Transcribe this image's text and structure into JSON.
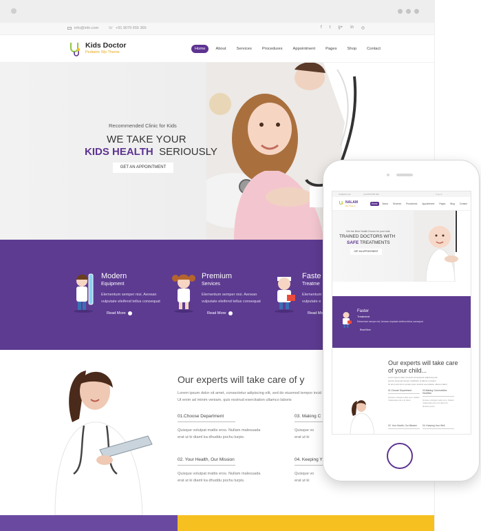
{
  "topbar": {
    "email": "info@info.com",
    "phone": "+91 9079 655 366",
    "social_icons": [
      "facebook-icon",
      "twitter-icon",
      "google-plus-icon",
      "linkedin-icon",
      "dribbble-icon"
    ],
    "social_glyphs": [
      "f",
      "t",
      "g+",
      "in",
      "◎"
    ]
  },
  "header": {
    "logo_name": "Kids Doctor",
    "logo_tagline": "Pediatric Wp Theme",
    "nav": [
      "Home",
      "About",
      "Services",
      "Procedures",
      "Appointment",
      "Pages",
      "Shop",
      "Contact"
    ],
    "active_nav": "Home"
  },
  "hero": {
    "kicker": "Recommended Clinic for Kids",
    "title_line1": "WE TAKE YOUR",
    "title_highlight": "KIDS HEALTH",
    "title_rest": "SERIOUSLY",
    "cta": "GET AN APPOINTMENT"
  },
  "features": [
    {
      "title": "Modern",
      "subtitle": "Equipment",
      "desc_line1": "Elementum semper nisi. Aenean",
      "desc_line2": "vulputate eleifend tellus consequat",
      "more": "Read More"
    },
    {
      "title": "Premium",
      "subtitle": "Services",
      "desc_line1": "Elementum semper nisi. Aenean",
      "desc_line2": "vulputate eleifend tellus consequat",
      "more": "Read More"
    },
    {
      "title": "Faste",
      "subtitle": "Treatme",
      "desc_line1": "Elementum",
      "desc_line2": "vulputate e",
      "more": "Read More"
    }
  ],
  "experts": {
    "title": "Our experts will take care of y",
    "intro_line1": "Lorem ipsum dolor sit amet, consectetur adipiscing elit, sed do eiusmod tempor incid",
    "intro_line2": "Ut enim ad minim veniam, quis nostrud exercitation ullamco laboris",
    "items": [
      {
        "heading": "01.Choose Department",
        "line1": "Quisque volutpat mattis eros. Nullam malesuada",
        "line2": "erat ut ki diaml ka dhuddu pochu turpis."
      },
      {
        "heading": "03. Making C",
        "line1": "Quisque vo",
        "line2": "erat ut ki"
      },
      {
        "heading": "02. Your Health, Our Mission",
        "line1": "Quisque volutpat mattis eros. Nullam malesuada",
        "line2": "erat ut ki diaml ka dhuddu pochu turpis."
      },
      {
        "heading": "04. Keeping Y",
        "line1": "Quisque vo",
        "line2": "erat ut ki"
      }
    ]
  },
  "phone": {
    "topbar_email": "info@info.com",
    "topbar_phone": "+91 9079 655 366",
    "logo_name": "NALAM",
    "logo_tagline": "Wp Theme",
    "nav": [
      "Home",
      "About",
      "Services",
      "Procedures",
      "Appointment",
      "Pages",
      "Blog",
      "Contact"
    ],
    "hero_kicker": "Get the Best Health Doctor for your kids",
    "hero_line1": "TRAINED DOCTORS WITH",
    "hero_highlight": "SAFE",
    "hero_rest": "TREATMENTS",
    "hero_cta": "GET AN APPOINTMENT",
    "feature_title": "Faster",
    "feature_sub": "Treatment",
    "feature_desc": "Elementum semper nisi. Aenean vulputate eleifend tellus consequat",
    "feature_more": "Read More",
    "experts_title": "Our experts will take care of your child...",
    "experts_p1": "Lorem ipsum dolor sit amet consectetur adipiscing elit,",
    "experts_p2": "sed do eiusmod tempor incididunt ut labore et dolore",
    "experts_p3": "Ut enim ad minim veniam quis nostrud exercitation ullamco labor",
    "items": [
      {
        "heading": "01.Choose Department",
        "text": "Quisque volutpat mattis eros. Nullam malesuada erat ut ki diaml"
      },
      {
        "heading": "03.Making Communities Healthier",
        "text": "Quisque volutpat mattis eros. Nullam malesuada erat ut ki diaml ka dhuddu pochu"
      },
      {
        "heading": "02. Your Health, Our Mission",
        "text": ""
      },
      {
        "heading": "04. Keeping Your Well",
        "text": ""
      }
    ]
  },
  "colors": {
    "brand_purple": "#5d3391",
    "feature_band": "#5d3b91",
    "accent_yellow": "#f7c021"
  }
}
